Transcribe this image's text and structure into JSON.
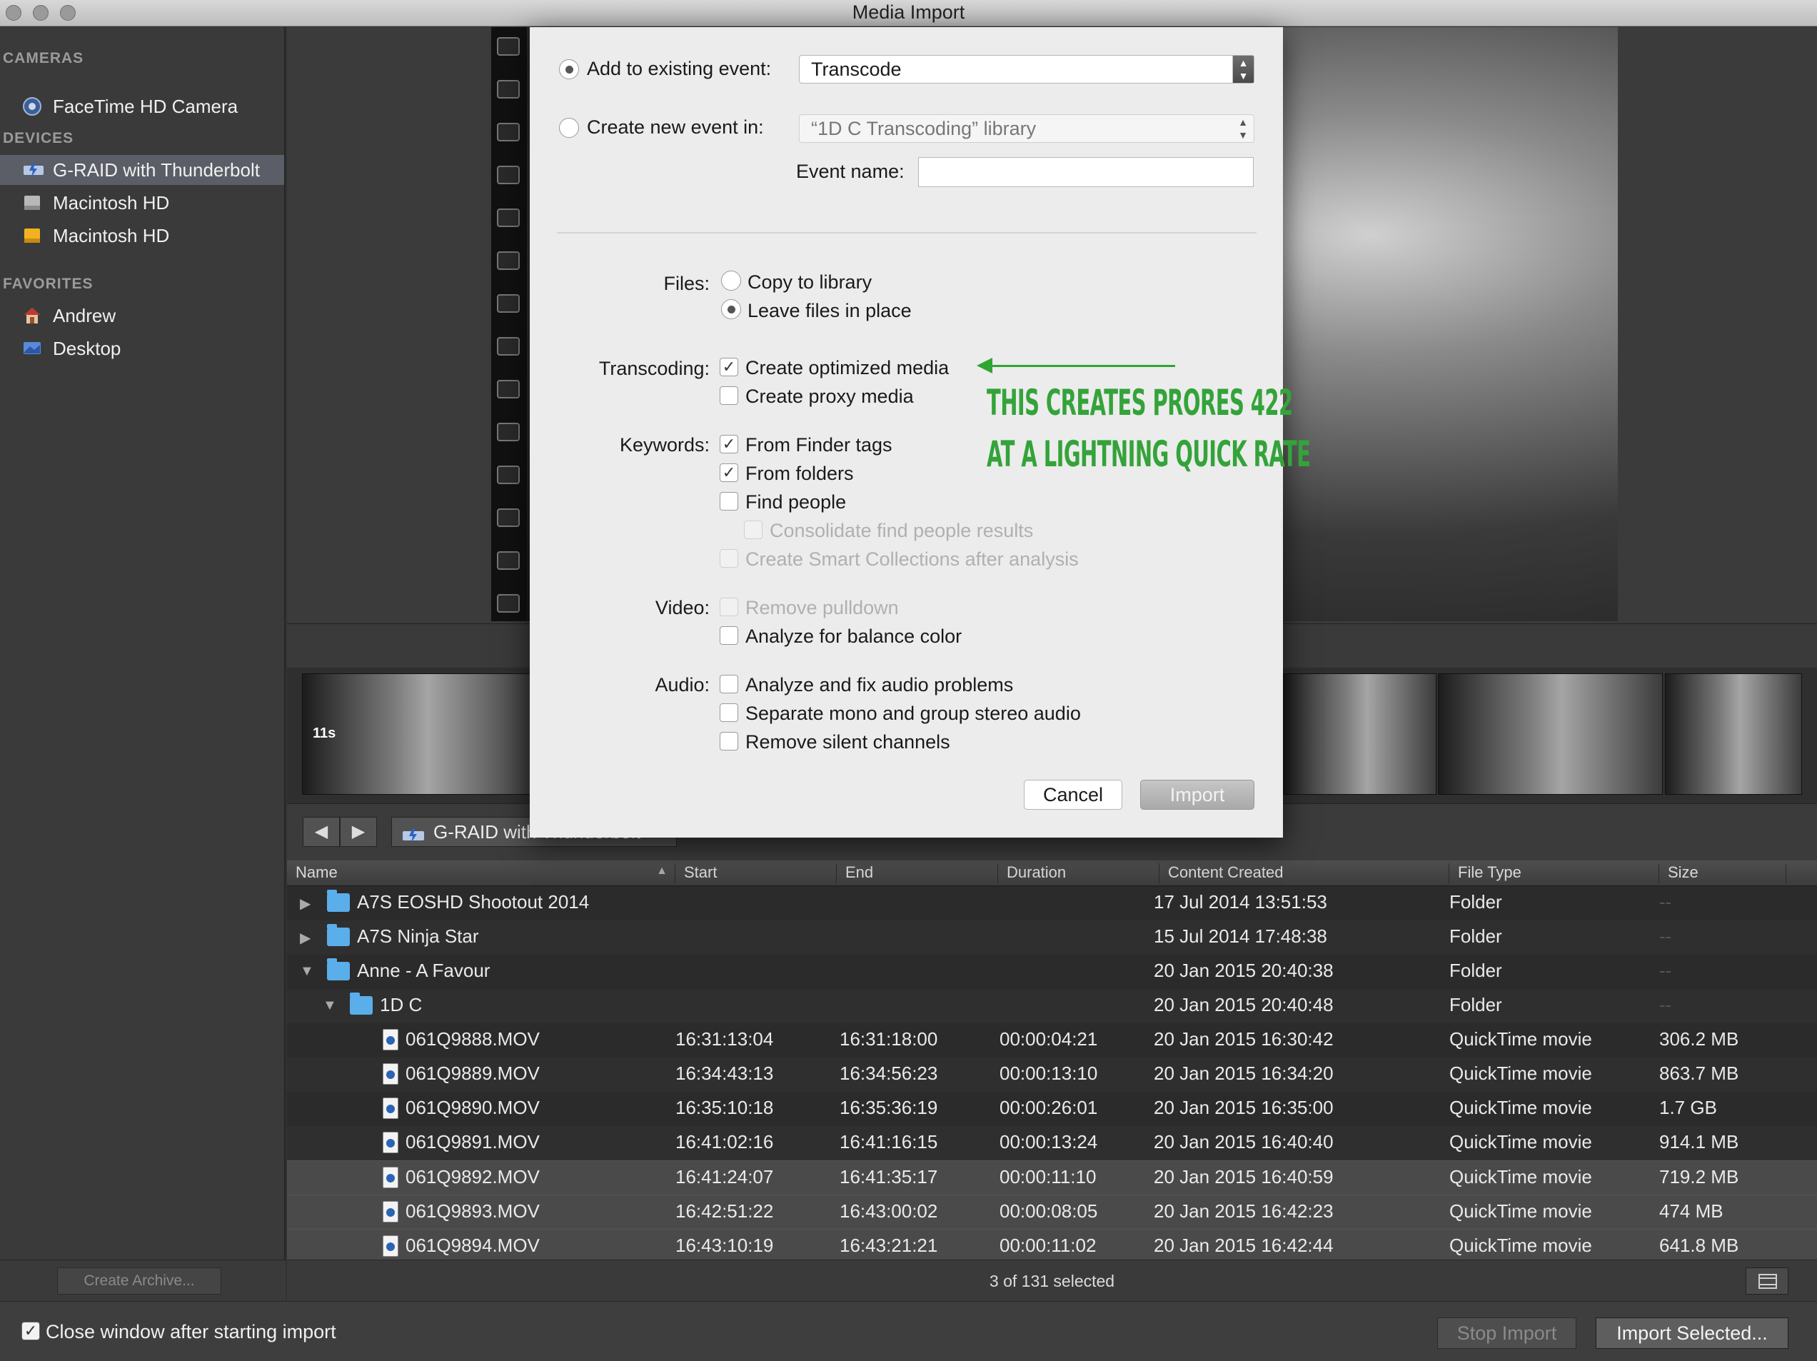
{
  "window": {
    "title": "Media Import"
  },
  "sidebar": {
    "cameras_heading": "CAMERAS",
    "cameras": [
      {
        "label": "FaceTime HD Camera"
      }
    ],
    "devices_heading": "DEVICES",
    "devices": [
      {
        "label": "G-RAID with Thunderbolt",
        "selected": true
      },
      {
        "label": "Macintosh HD"
      },
      {
        "label": "Macintosh HD"
      }
    ],
    "favorites_heading": "FAVORITES",
    "favorites": [
      {
        "label": "Andrew"
      },
      {
        "label": "Desktop"
      }
    ],
    "create_archive_label": "Create Archive..."
  },
  "thumbnails": {
    "first_clip_duration": "11s"
  },
  "nav": {
    "back": "◀",
    "forward": "▶",
    "drive_label": "G-RAID with Thunderbolt"
  },
  "dialog": {
    "add_existing_label": "Add to existing event:",
    "existing_event_value": "Transcode",
    "create_new_label": "Create new event in:",
    "new_event_library": "“1D C Transcoding” library",
    "event_name_label": "Event name:",
    "event_name_value": "",
    "files_label": "Files:",
    "copy_to_library": "Copy to library",
    "leave_in_place": "Leave files in place",
    "transcoding_label": "Transcoding:",
    "create_optimized": "Create optimized media",
    "create_proxy": "Create proxy media",
    "keywords_label": "Keywords:",
    "from_finder_tags": "From Finder tags",
    "from_folders": "From folders",
    "find_people": "Find people",
    "consolidate_people": "Consolidate find people results",
    "create_smart_collections": "Create Smart Collections after analysis",
    "video_label": "Video:",
    "remove_pulldown": "Remove pulldown",
    "analyze_balance": "Analyze for balance color",
    "audio_label": "Audio:",
    "analyze_audio": "Analyze and fix audio problems",
    "separate_mono": "Separate mono and group stereo audio",
    "remove_silent": "Remove silent channels",
    "cancel_label": "Cancel",
    "import_label": "Import",
    "annotation_line1": "THIS CREATES PRORES 422",
    "annotation_line2": "AT A LIGHTNING QUICK RATE"
  },
  "table": {
    "columns": {
      "name": "Name",
      "start": "Start",
      "end": "End",
      "duration": "Duration",
      "created": "Content Created",
      "type": "File Type",
      "size": "Size"
    },
    "rows": [
      {
        "kind": "folder",
        "depth": 0,
        "open": false,
        "name": "A7S EOSHD Shootout 2014",
        "start": "",
        "end": "",
        "duration": "",
        "created": "17 Jul 2014 13:51:53",
        "type": "Folder",
        "size": "--"
      },
      {
        "kind": "folder",
        "depth": 0,
        "open": false,
        "name": "A7S Ninja Star",
        "start": "",
        "end": "",
        "duration": "",
        "created": "15 Jul 2014 17:48:38",
        "type": "Folder",
        "size": "--"
      },
      {
        "kind": "folder",
        "depth": 0,
        "open": true,
        "name": "Anne - A Favour",
        "start": "",
        "end": "",
        "duration": "",
        "created": "20 Jan 2015 20:40:38",
        "type": "Folder",
        "size": "--"
      },
      {
        "kind": "folder",
        "depth": 1,
        "open": true,
        "name": "1D C",
        "start": "",
        "end": "",
        "duration": "",
        "created": "20 Jan 2015 20:40:48",
        "type": "Folder",
        "size": "--"
      },
      {
        "kind": "file",
        "depth": 2,
        "name": "061Q9888.MOV",
        "start": "16:31:13:04",
        "end": "16:31:18:00",
        "duration": "00:00:04:21",
        "created": "20 Jan 2015 16:30:42",
        "type": "QuickTime movie",
        "size": "306.2 MB"
      },
      {
        "kind": "file",
        "depth": 2,
        "name": "061Q9889.MOV",
        "start": "16:34:43:13",
        "end": "16:34:56:23",
        "duration": "00:00:13:10",
        "created": "20 Jan 2015 16:34:20",
        "type": "QuickTime movie",
        "size": "863.7 MB"
      },
      {
        "kind": "file",
        "depth": 2,
        "name": "061Q9890.MOV",
        "start": "16:35:10:18",
        "end": "16:35:36:19",
        "duration": "00:00:26:01",
        "created": "20 Jan 2015 16:35:00",
        "type": "QuickTime movie",
        "size": "1.7 GB"
      },
      {
        "kind": "file",
        "depth": 2,
        "name": "061Q9891.MOV",
        "start": "16:41:02:16",
        "end": "16:41:16:15",
        "duration": "00:00:13:24",
        "created": "20 Jan 2015 16:40:40",
        "type": "QuickTime movie",
        "size": "914.1 MB"
      },
      {
        "kind": "file",
        "depth": 2,
        "selected": true,
        "name": "061Q9892.MOV",
        "start": "16:41:24:07",
        "end": "16:41:35:17",
        "duration": "00:00:11:10",
        "created": "20 Jan 2015 16:40:59",
        "type": "QuickTime movie",
        "size": "719.2 MB"
      },
      {
        "kind": "file",
        "depth": 2,
        "selected": true,
        "name": "061Q9893.MOV",
        "start": "16:42:51:22",
        "end": "16:43:00:02",
        "duration": "00:00:08:05",
        "created": "20 Jan 2015 16:42:23",
        "type": "QuickTime movie",
        "size": "474 MB"
      },
      {
        "kind": "file",
        "depth": 2,
        "selected": true,
        "name": "061Q9894.MOV",
        "start": "16:43:10:19",
        "end": "16:43:21:21",
        "duration": "00:00:11:02",
        "created": "20 Jan 2015 16:42:44",
        "type": "QuickTime movie",
        "size": "641.8 MB"
      }
    ]
  },
  "status": {
    "selected_count": "3 of 131 selected"
  },
  "bottom": {
    "close_after_import": "Close window after starting import",
    "stop_import": "Stop Import",
    "import_selected": "Import Selected..."
  },
  "colors": {
    "accent_green": "#34a33a",
    "folder_blue": "#5aaeea",
    "selection": "#5b5e66"
  }
}
